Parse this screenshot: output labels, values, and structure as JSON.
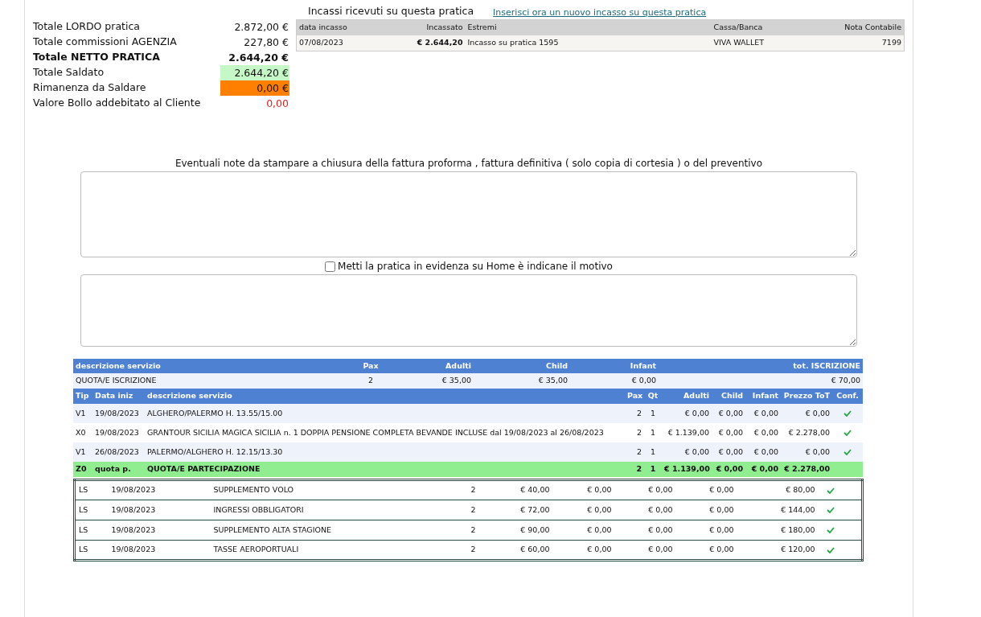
{
  "summary": [
    {
      "label": "Totale LORDO pratica",
      "value": "2.872,00 €",
      "kind": "normal"
    },
    {
      "label": "Totale commissioni AGENZIA",
      "value": "227,80 €",
      "kind": "normal"
    },
    {
      "label": "Totale NETTO PRATICA",
      "value": "2.644,20 €",
      "kind": "bold"
    },
    {
      "label": "Totale Saldato",
      "value": "2.644,20 €",
      "kind": "paid"
    },
    {
      "label": "Rimanenza da Saldare",
      "value": "0,00 €",
      "kind": "remaining"
    },
    {
      "label": "Valore Bollo addebitato al Cliente",
      "value": "0,00",
      "kind": "stamp"
    }
  ],
  "payments": {
    "title": "Incassi ricevuti su questa pratica",
    "link": "Inserisci ora un nuovo incasso su questa pratica",
    "columns": [
      "data incasso",
      "Incassato",
      "Estremi",
      "Cassa/Banca",
      "Nota Contabile"
    ],
    "rows": [
      {
        "cells": [
          "07/08/2023",
          "€ 2.644,20",
          "Incasso su pratica 1595",
          "VIVA WALLET",
          "7199"
        ]
      }
    ]
  },
  "notes": {
    "label": "Eventuali note da stampare a chiusura della fattura proforma , fattura definitiva ( solo copia di cortesia ) o del preventivo"
  },
  "highlight": {
    "label": "Metti la pratica in evidenza su Home è indicane il motivo",
    "checked": false
  },
  "registration": {
    "columns": [
      "descrizione servizio",
      "Pax",
      "Adulti",
      "Child",
      "Infant",
      "tot. ISCRIZIONE"
    ],
    "rows": [
      {
        "cells": [
          "QUOTA/E ISCRIZIONE",
          "2",
          "€ 35,00",
          "€ 35,00",
          "€ 0,00",
          "€ 70,00"
        ]
      }
    ]
  },
  "services": {
    "columns": [
      "Tip",
      "Data iniz",
      "descrizione servizio",
      "Pax",
      "Qt",
      "Adulti",
      "Child",
      "Infant",
      "Prezzo ToT",
      "Conf."
    ],
    "rows": [
      {
        "kind": "item",
        "cells": [
          "V1",
          "19/08/2023",
          "ALGHERO/PALERMO H. 13.55/15.00",
          "2",
          "1",
          "€ 0,00",
          "€ 0,00",
          "€ 0,00",
          "€ 0,00"
        ],
        "confirmed": true
      },
      {
        "kind": "item",
        "cells": [
          "X0",
          "19/08/2023",
          "GRANTOUR SICILIA MAGICA SICILIA n. 1 DOPPIA PENSIONE COMPLETA BEVANDE INCLUSE dal 19/08/2023 al 26/08/2023",
          "2",
          "1",
          "€ 1.139,00",
          "€ 0,00",
          "€ 0,00",
          "€ 2.278,00"
        ],
        "confirmed": true
      },
      {
        "kind": "item",
        "cells": [
          "V1",
          "26/08/2023",
          "PALERMO/ALGHERO H. 12.15/13.30",
          "2",
          "1",
          "€ 0,00",
          "€ 0,00",
          "€ 0,00",
          "€ 0,00"
        ],
        "confirmed": true
      },
      {
        "kind": "total",
        "cells": [
          "Z0",
          "quota p.",
          "QUOTA/E PARTECIPAZIONE",
          "2",
          "1",
          "€ 1.139,00",
          "€ 0,00",
          "€ 0,00",
          "€ 2.278,00"
        ],
        "confirmed": false
      }
    ]
  },
  "supplements": [
    {
      "cells": [
        "LS",
        "19/08/2023",
        "SUPPLEMENTO VOLO",
        "2",
        "€ 40,00",
        "€ 0,00",
        "€ 0,00",
        "€ 0,00",
        "€ 80,00"
      ],
      "confirmed": true
    },
    {
      "cells": [
        "LS",
        "19/08/2023",
        "INGRESSI OBBLIGATORI",
        "2",
        "€ 72,00",
        "€ 0,00",
        "€ 0,00",
        "€ 0,00",
        "€ 144,00"
      ],
      "confirmed": true
    },
    {
      "cells": [
        "LS",
        "19/08/2023",
        "SUPPLEMENTO ALTA STAGIONE",
        "2",
        "€ 90,00",
        "€ 0,00",
        "€ 0,00",
        "€ 0,00",
        "€ 180,00"
      ],
      "confirmed": true
    },
    {
      "cells": [
        "LS",
        "19/08/2023",
        "TASSE AEROPORTUALI",
        "2",
        "€ 60,00",
        "€ 0,00",
        "€ 0,00",
        "€ 0,00",
        "€ 120,00"
      ],
      "confirmed": true
    }
  ]
}
